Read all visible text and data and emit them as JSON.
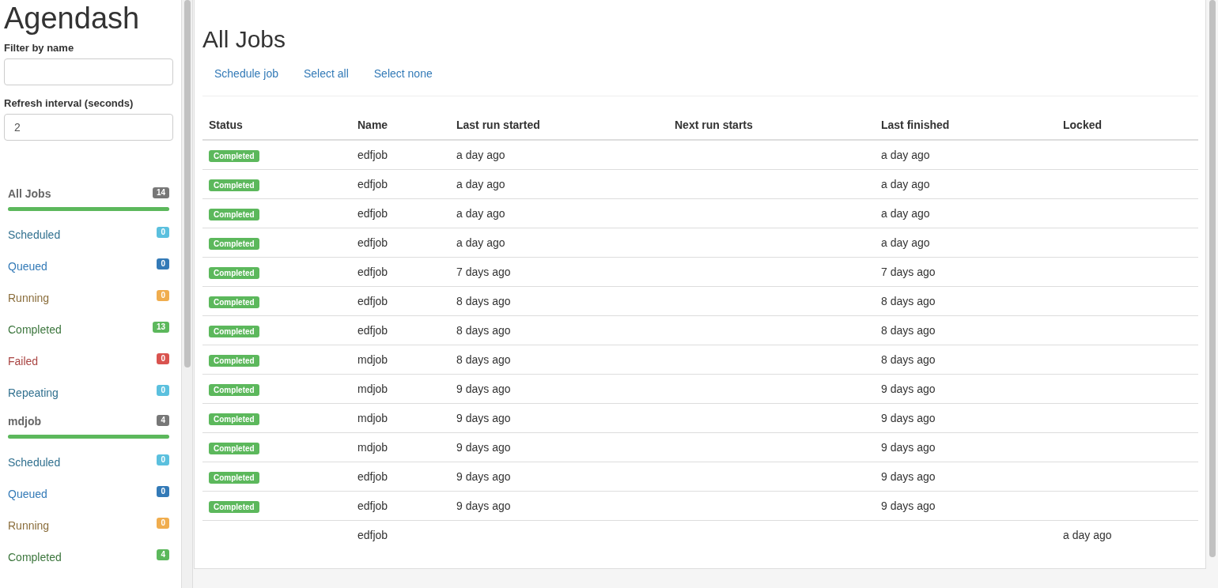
{
  "sidebar": {
    "title": "Agendash",
    "filter": {
      "label": "Filter by name"
    },
    "refresh": {
      "label": "Refresh interval (seconds)",
      "value": "2"
    },
    "groups": [
      {
        "name": "All Jobs",
        "count": "14",
        "level": 1,
        "items": [
          {
            "label": "Scheduled",
            "count": "0",
            "kind": "scheduled"
          },
          {
            "label": "Queued",
            "count": "0",
            "kind": "queued"
          },
          {
            "label": "Running",
            "count": "0",
            "kind": "running"
          },
          {
            "label": "Completed",
            "count": "13",
            "kind": "completed"
          },
          {
            "label": "Failed",
            "count": "0",
            "kind": "failed"
          },
          {
            "label": "Repeating",
            "count": "0",
            "kind": "repeating"
          }
        ]
      },
      {
        "name": "mdjob",
        "count": "4",
        "level": 1,
        "items": [
          {
            "label": "Scheduled",
            "count": "0",
            "kind": "scheduled"
          },
          {
            "label": "Queued",
            "count": "0",
            "kind": "queued"
          },
          {
            "label": "Running",
            "count": "0",
            "kind": "running"
          },
          {
            "label": "Completed",
            "count": "4",
            "kind": "completed"
          }
        ]
      }
    ]
  },
  "main": {
    "title": "All Jobs",
    "actions": [
      "Schedule job",
      "Select all",
      "Select none"
    ],
    "table": {
      "columns": [
        "Status",
        "Name",
        "Last run started",
        "Next run starts",
        "Last finished",
        "Locked"
      ],
      "rows": [
        {
          "status": "Completed",
          "name": "edfjob",
          "last_run_started": "a day ago",
          "last_finished": "a day ago"
        },
        {
          "status": "Completed",
          "name": "edfjob",
          "last_run_started": "a day ago",
          "last_finished": "a day ago"
        },
        {
          "status": "Completed",
          "name": "edfjob",
          "last_run_started": "a day ago",
          "last_finished": "a day ago"
        },
        {
          "status": "Completed",
          "name": "edfjob",
          "last_run_started": "a day ago",
          "last_finished": "a day ago"
        },
        {
          "status": "Completed",
          "name": "edfjob",
          "last_run_started": "7 days ago",
          "last_finished": "7 days ago"
        },
        {
          "status": "Completed",
          "name": "edfjob",
          "last_run_started": "8 days ago",
          "last_finished": "8 days ago"
        },
        {
          "status": "Completed",
          "name": "edfjob",
          "last_run_started": "8 days ago",
          "last_finished": "8 days ago"
        },
        {
          "status": "Completed",
          "name": "mdjob",
          "last_run_started": "8 days ago",
          "last_finished": "8 days ago"
        },
        {
          "status": "Completed",
          "name": "mdjob",
          "last_run_started": "9 days ago",
          "last_finished": "9 days ago"
        },
        {
          "status": "Completed",
          "name": "mdjob",
          "last_run_started": "9 days ago",
          "last_finished": "9 days ago"
        },
        {
          "status": "Completed",
          "name": "mdjob",
          "last_run_started": "9 days ago",
          "last_finished": "9 days ago"
        },
        {
          "status": "Completed",
          "name": "edfjob",
          "last_run_started": "9 days ago",
          "last_finished": "9 days ago"
        },
        {
          "status": "Completed",
          "name": "edfjob",
          "last_run_started": "9 days ago",
          "last_finished": "9 days ago"
        },
        {
          "name": "edfjob",
          "locked": "a day ago"
        }
      ]
    }
  }
}
